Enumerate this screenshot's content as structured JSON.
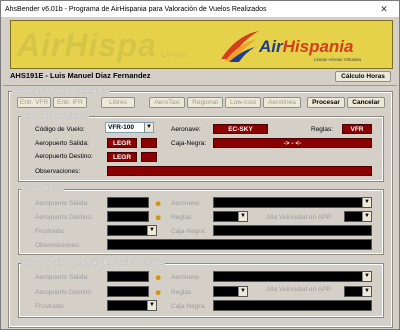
{
  "window": {
    "title": "AhsBender v6.01b - Programa de AirHispania para Valoración de Vuelos Realizados",
    "close_glyph": "✕"
  },
  "banner": {
    "ghost_text": "AirHispa",
    "ghost_sub": "Lineas",
    "brand_air": "Air",
    "brand_rest": "Hispania",
    "slogan": "Lineas Aéreas Virtuales"
  },
  "user": {
    "label": "AHS191E  -  Luis Manuel Diaz Fernandez",
    "calc_button": "Cálculo Horas"
  },
  "valoracion": {
    "title": "Valoración de vuelos Realizados:",
    "buttons": [
      "Entr. VFR",
      "Entr. IFR",
      "Libres",
      "AeroTaxi",
      "Regional",
      "Low-cost",
      "Aerolínea"
    ],
    "procesar": "Procesar",
    "cancelar": "Cancelar"
  },
  "entrenamiento": {
    "title": "Vuelos Entrenamiento:",
    "codigo_label": "Código de Vuelo:",
    "codigo_value": "VFR-100",
    "aeronave_label": "Aeronave:",
    "aeronave_value": "EC-SKY",
    "reglas_label": "Reglas:",
    "reglas_value": "VFR",
    "salida_label": "Aeropuerto Salida:",
    "salida_value": "LEGR",
    "destino_label": "Aeropuerto Destino:",
    "destino_value": "LEGR",
    "caja_label": "Caja-Negra:",
    "caja_value": "-> - <-",
    "obs_label": "Observaciones:"
  },
  "libres": {
    "title": "Vuelos Libres:",
    "salida_label": "Aeropuerto Salida:",
    "destino_label": "Aeropuerto Destino:",
    "frustrada_label": "Frustrada:",
    "obs_label": "Observaciones:",
    "aeronave_label": "Aeronave:",
    "reglas_label": "Reglas:",
    "caja_label": "Caja-Negra:",
    "app_label": "Alta Velocidad en APP:"
  },
  "aerotaxi": {
    "title": "Vuelos Aerotaxi / Regional / Low-cost / Aerolínea:",
    "salida_label": "Aeropuerto Salida:",
    "destino_label": "Aeropuerto Destino:",
    "frustrada_label": "Frustrada:",
    "aeronave_label": "Aeronave:",
    "reglas_label": "Reglas:",
    "caja_label": "Caja-Negra:",
    "app_label": "Alta Velocidad en APP:"
  },
  "icons": {
    "arrow": "▼",
    "person": "☻"
  },
  "colors": {
    "banner": "#e6d24a",
    "red_field": "#8b0000",
    "brand_blue": "#1b3f8c",
    "brand_red": "#d43d1e"
  }
}
